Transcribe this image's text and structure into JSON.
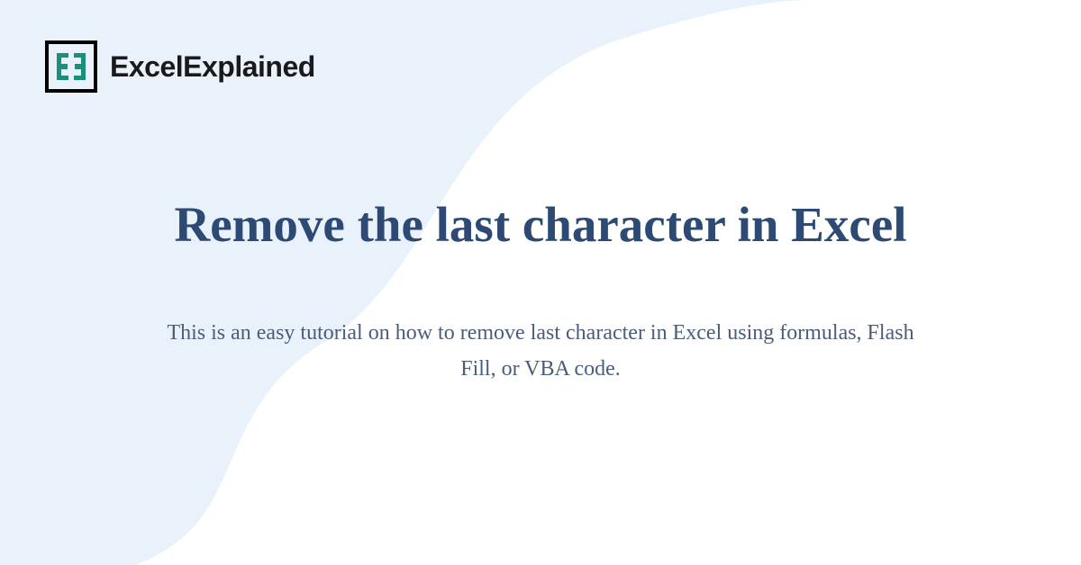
{
  "logo": {
    "brand_bold": "Excel",
    "brand_rest": "Explained",
    "icon_name": "excel-explained-logo"
  },
  "heading": "Remove the last character in Excel",
  "description": "This is an easy tutorial on how to remove last character in Excel using formulas, Flash Fill, or VBA code.",
  "colors": {
    "accent": "#2d4a75",
    "bg_wave": "#e9f1fb",
    "logo_teal": "#1a8f7a"
  }
}
